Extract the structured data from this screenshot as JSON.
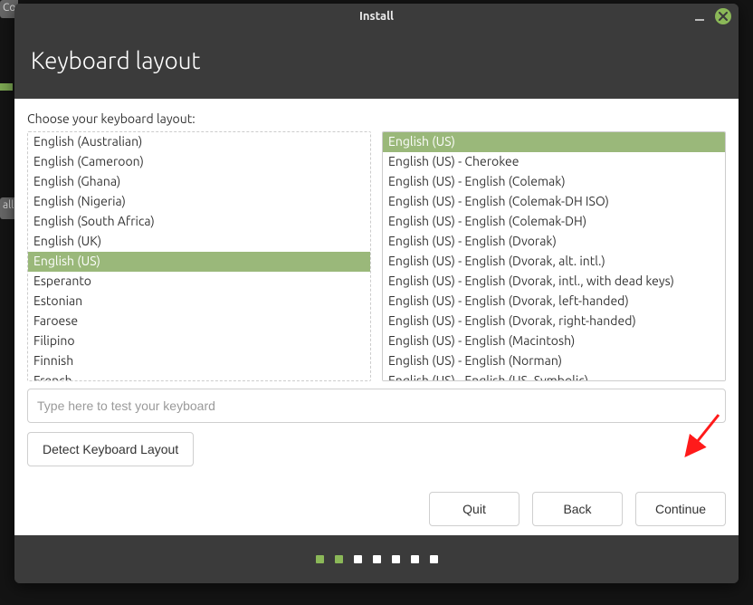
{
  "desktop": {
    "frag_top": "Co",
    "frag_side": "all"
  },
  "window": {
    "title": "Install"
  },
  "hero": {
    "title": "Keyboard layout"
  },
  "prompt": "Choose your keyboard layout:",
  "layouts": {
    "selected_index": 6,
    "items": [
      "English (Australian)",
      "English (Cameroon)",
      "English (Ghana)",
      "English (Nigeria)",
      "English (South Africa)",
      "English (UK)",
      "English (US)",
      "Esperanto",
      "Estonian",
      "Faroese",
      "Filipino",
      "Finnish",
      "French"
    ]
  },
  "variants": {
    "selected_index": 0,
    "items": [
      "English (US)",
      "English (US) - Cherokee",
      "English (US) - English (Colemak)",
      "English (US) - English (Colemak-DH ISO)",
      "English (US) - English (Colemak-DH)",
      "English (US) - English (Dvorak)",
      "English (US) - English (Dvorak, alt. intl.)",
      "English (US) - English (Dvorak, intl., with dead keys)",
      "English (US) - English (Dvorak, left-handed)",
      "English (US) - English (Dvorak, right-handed)",
      "English (US) - English (Macintosh)",
      "English (US) - English (Norman)",
      "English (US) - English (US, Symbolic)"
    ]
  },
  "test_input": {
    "value": "",
    "placeholder": "Type here to test your keyboard"
  },
  "buttons": {
    "detect": "Detect Keyboard Layout",
    "quit": "Quit",
    "back": "Back",
    "continue": "Continue"
  },
  "pager": {
    "total": 7,
    "active": [
      0,
      1
    ]
  },
  "colors": {
    "accent": "#8bb858",
    "arrow": "#ff0000"
  }
}
